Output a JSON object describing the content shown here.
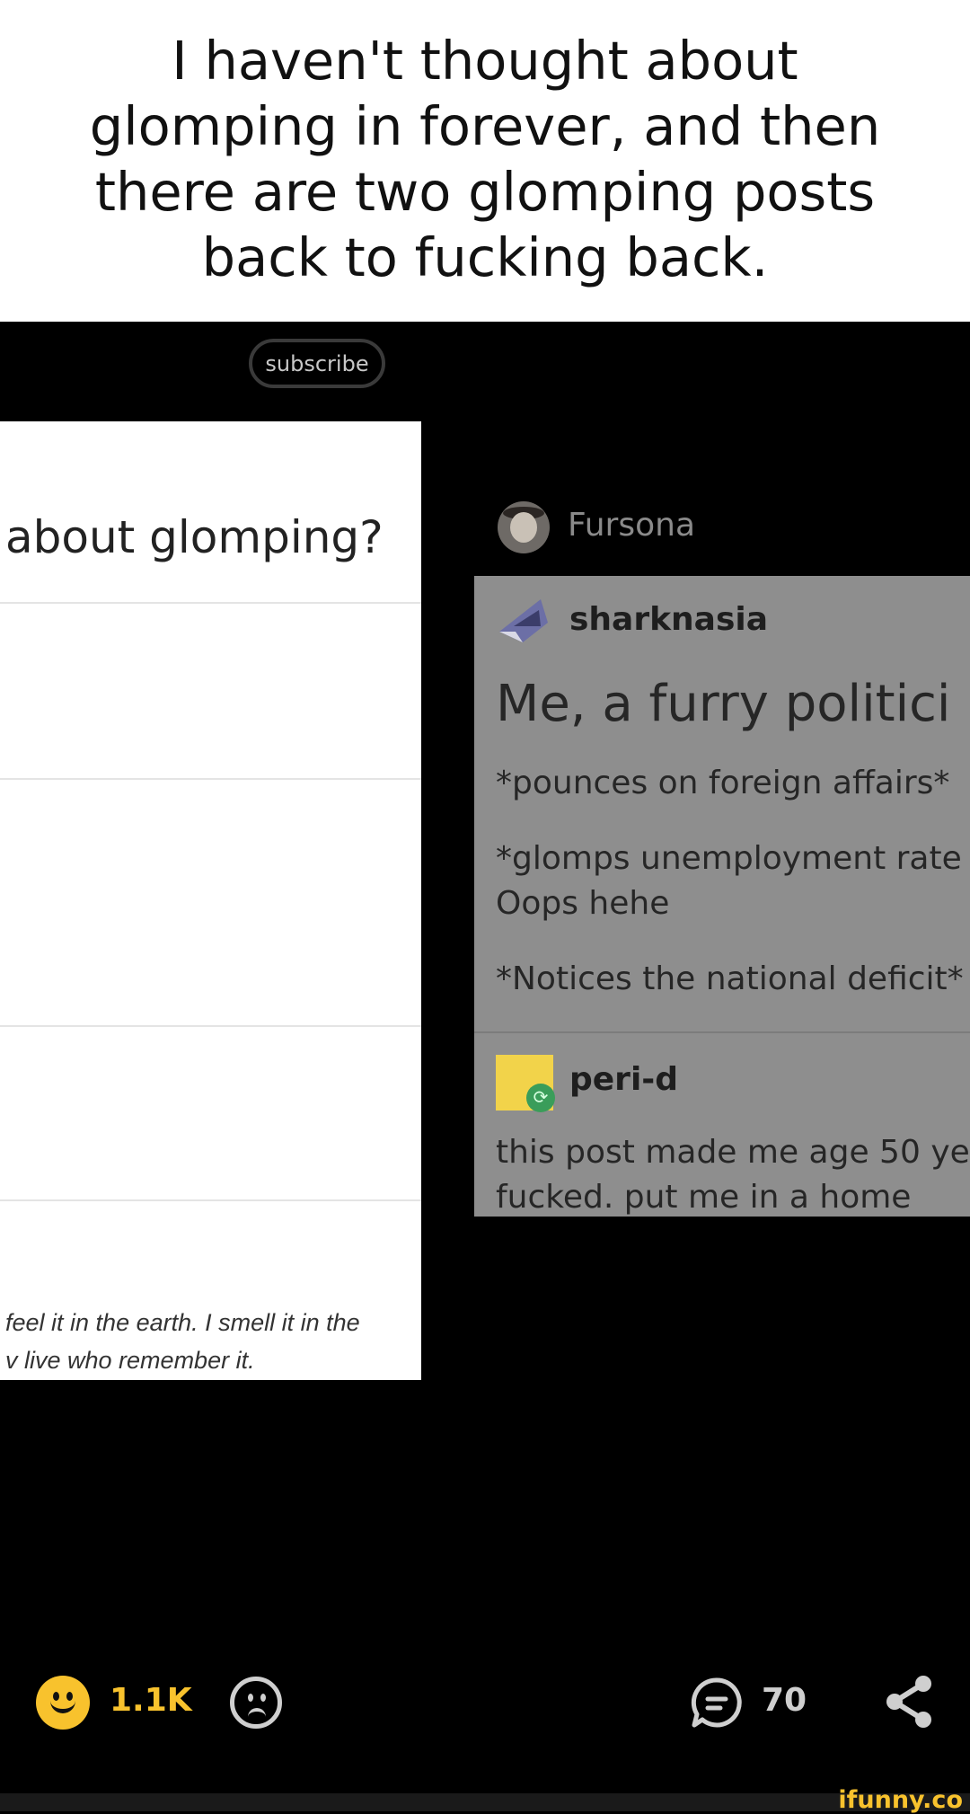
{
  "caption": {
    "text": "I haven't thought about glomping in forever, and then there are two glomping posts back to fucking back."
  },
  "header": {
    "subscribe_label": "subscribe"
  },
  "left_post": {
    "title": "about glomping?",
    "quote_line1": "feel it in the earth. I smell it in the",
    "quote_line2": "v live who remember it."
  },
  "right_post": {
    "fursona_label": "Fursona",
    "user1": "sharknasia",
    "title": "Me, a furry politici",
    "line1": "*pounces on foreign affairs*",
    "line2": "*glomps unemployment rate",
    "line3": "Oops hehe",
    "line4": "*Notices the national deficit*",
    "user2": "peri-d",
    "reply_line1": "this post made me age 50 ye",
    "reply_line2": "fucked. put me in a home"
  },
  "actions": {
    "smile_count": "1.1K",
    "comment_count": "70",
    "icons": [
      "smile-icon",
      "frown-icon",
      "comment-icon",
      "share-icon"
    ]
  },
  "footer": {
    "watermark": "ifunny.co"
  },
  "colors": {
    "accent": "#f8c22d",
    "background": "#000000"
  }
}
